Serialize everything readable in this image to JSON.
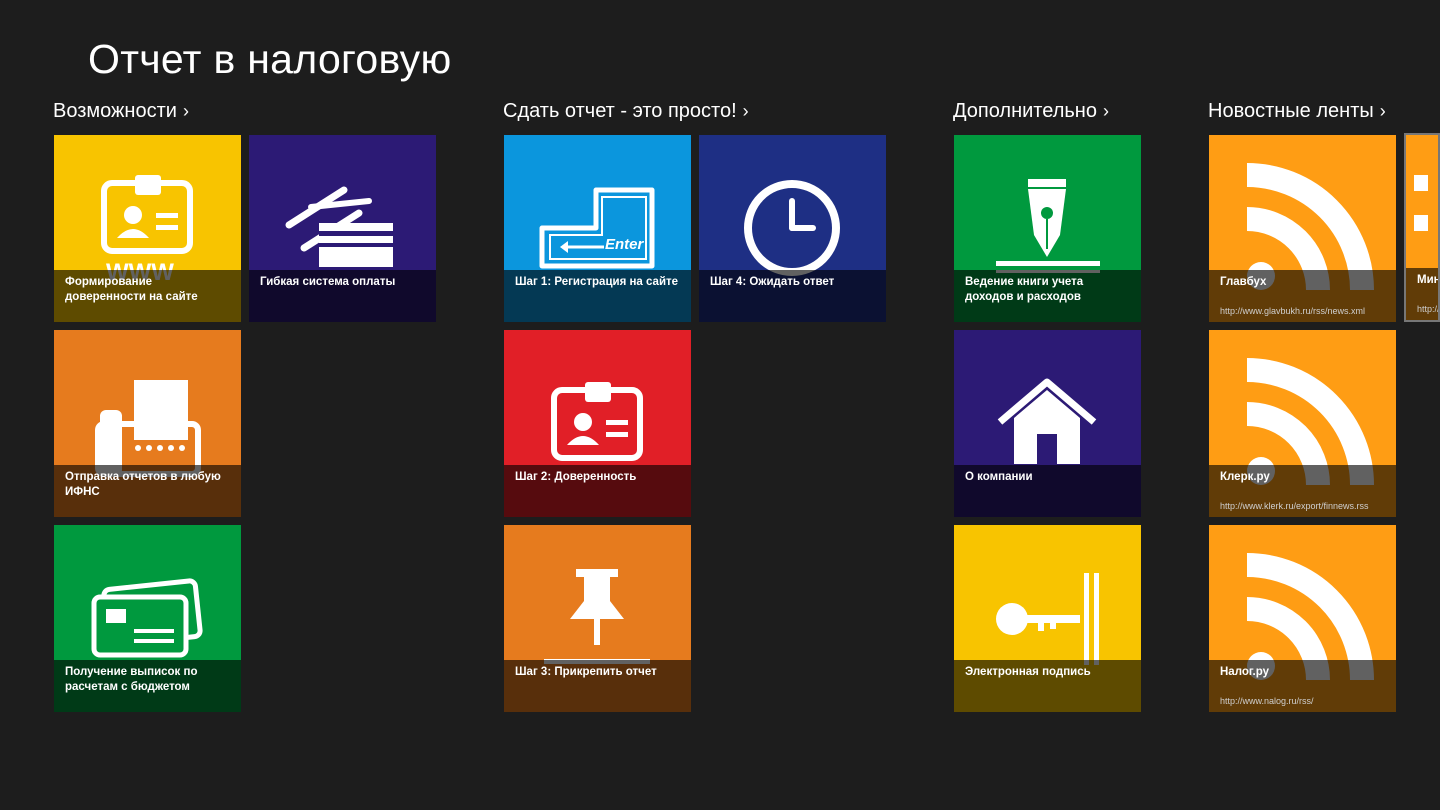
{
  "app": {
    "title": "Отчет в налоговую"
  },
  "sections": {
    "features": {
      "title": "Возможности",
      "chevron": "›"
    },
    "simple": {
      "title": "Сдать отчет - это просто!",
      "chevron": "›"
    },
    "extra": {
      "title": "Дополнительно",
      "chevron": "›"
    },
    "news": {
      "title": "Новостные ленты",
      "chevron": "›"
    }
  },
  "tiles": {
    "power_of_attorney": {
      "label": "Формирование доверенности на сайте",
      "icon": "id-card-www-icon",
      "color": "#f8c400"
    },
    "payment": {
      "label": "Гибкая система оплаты",
      "icon": "credit-cards-icon",
      "color": "#2c1a75"
    },
    "send_reports": {
      "label": "Отправка отчетов в любую ИФНС",
      "icon": "fax-icon",
      "color": "#e67b1e"
    },
    "statements": {
      "label": "Получение выписок по расчетам с бюджетом",
      "icon": "cards-icon",
      "color": "#00993e"
    },
    "step1": {
      "label": "Шаг 1: Регистрация на сайте",
      "icon": "enter-key-icon",
      "color": "#0b96dd"
    },
    "step4": {
      "label": "Шаг 4: Ожидать ответ",
      "icon": "clock-icon",
      "color": "#1e2f84"
    },
    "step2": {
      "label": "Шаг 2: Доверенность",
      "icon": "id-card-icon",
      "color": "#e11f27"
    },
    "step3": {
      "label": "Шаг 3: Прикрепить отчет",
      "icon": "pushpin-icon",
      "color": "#e67b1e"
    },
    "ledger": {
      "label": "Ведение книги учета доходов и расходов",
      "icon": "fountain-pen-icon",
      "color": "#00993e"
    },
    "about": {
      "label": "О компании",
      "icon": "house-icon",
      "color": "#2c1a75"
    },
    "signature": {
      "label": "Электронная подпись",
      "icon": "key-icon",
      "color": "#f8c400"
    }
  },
  "feeds": [
    {
      "label": "Главбух",
      "url": "http://www.glavbukh.ru/rss/news.xml",
      "icon": "rss-icon",
      "color": "#ff9d14"
    },
    {
      "label": "Клерк.ру",
      "url": "http://www.klerk.ru/export/finnews.rss",
      "icon": "rss-icon",
      "color": "#ff9d14"
    },
    {
      "label": "Налог.ру",
      "url": "http://www.nalog.ru/rss/",
      "icon": "rss-icon",
      "color": "#ff9d14"
    },
    {
      "label": "Мин",
      "url": "http://",
      "icon": "rss-icon",
      "color": "#ff9d14"
    }
  ]
}
